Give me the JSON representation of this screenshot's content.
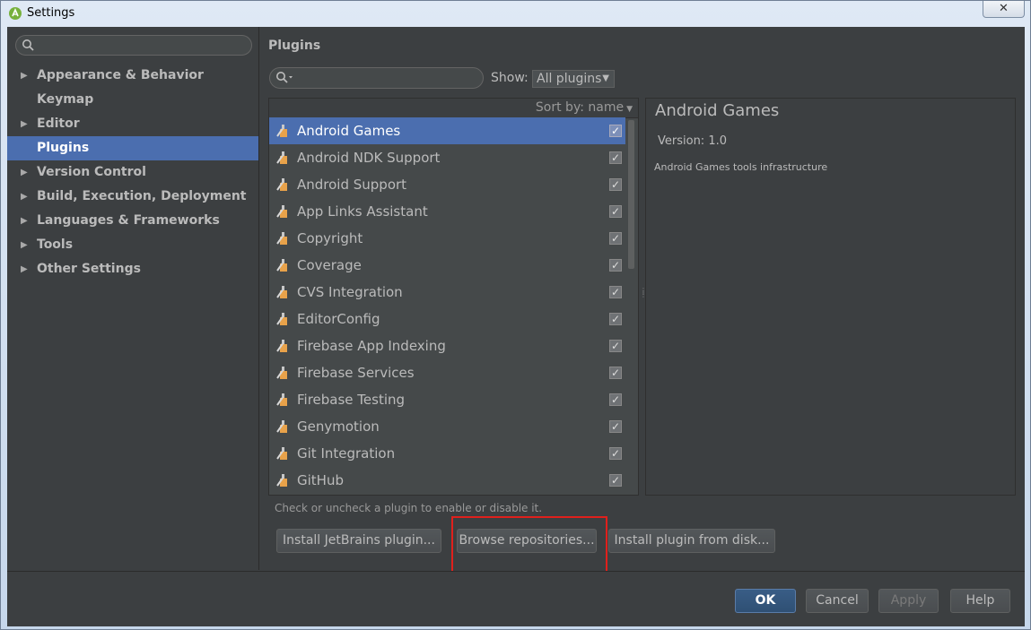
{
  "window": {
    "title": "Settings",
    "close_symbol": "✕"
  },
  "sidebar": {
    "search_placeholder": "",
    "items": [
      {
        "label": "Appearance & Behavior",
        "expandable": true,
        "selected": false
      },
      {
        "label": "Keymap",
        "expandable": false,
        "selected": false
      },
      {
        "label": "Editor",
        "expandable": true,
        "selected": false
      },
      {
        "label": "Plugins",
        "expandable": false,
        "selected": true
      },
      {
        "label": "Version Control",
        "expandable": true,
        "selected": false
      },
      {
        "label": "Build, Execution, Deployment",
        "expandable": true,
        "selected": false
      },
      {
        "label": "Languages & Frameworks",
        "expandable": true,
        "selected": false
      },
      {
        "label": "Tools",
        "expandable": true,
        "selected": false
      },
      {
        "label": "Other Settings",
        "expandable": true,
        "selected": false
      }
    ]
  },
  "main": {
    "title": "Plugins",
    "show_label": "Show:",
    "show_value": "All plugins",
    "sort_label": "Sort by: name",
    "plugins": [
      {
        "name": "Android Games",
        "checked": true,
        "selected": true
      },
      {
        "name": "Android NDK Support",
        "checked": true,
        "selected": false
      },
      {
        "name": "Android Support",
        "checked": true,
        "selected": false
      },
      {
        "name": "App Links Assistant",
        "checked": true,
        "selected": false
      },
      {
        "name": "Copyright",
        "checked": true,
        "selected": false
      },
      {
        "name": "Coverage",
        "checked": true,
        "selected": false
      },
      {
        "name": "CVS Integration",
        "checked": true,
        "selected": false
      },
      {
        "name": "EditorConfig",
        "checked": true,
        "selected": false
      },
      {
        "name": "Firebase App Indexing",
        "checked": true,
        "selected": false
      },
      {
        "name": "Firebase Services",
        "checked": true,
        "selected": false
      },
      {
        "name": "Firebase Testing",
        "checked": true,
        "selected": false
      },
      {
        "name": "Genymotion",
        "checked": true,
        "selected": false
      },
      {
        "name": "Git Integration",
        "checked": true,
        "selected": false
      },
      {
        "name": "GitHub",
        "checked": true,
        "selected": false
      }
    ],
    "details": {
      "title": "Android Games",
      "version": "Version: 1.0",
      "description": "Android Games tools infrastructure"
    },
    "hint": "Check or uncheck a plugin to enable or disable it.",
    "buttons": {
      "install_jetbrains": "Install JetBrains plugin...",
      "browse": "Browse repositories...",
      "install_disk": "Install plugin from disk..."
    }
  },
  "footer": {
    "ok": "OK",
    "cancel": "Cancel",
    "apply": "Apply",
    "help": "Help"
  },
  "colors": {
    "selection": "#4b6eaf",
    "background": "#3c3f41",
    "highlight": "#e0201c"
  }
}
